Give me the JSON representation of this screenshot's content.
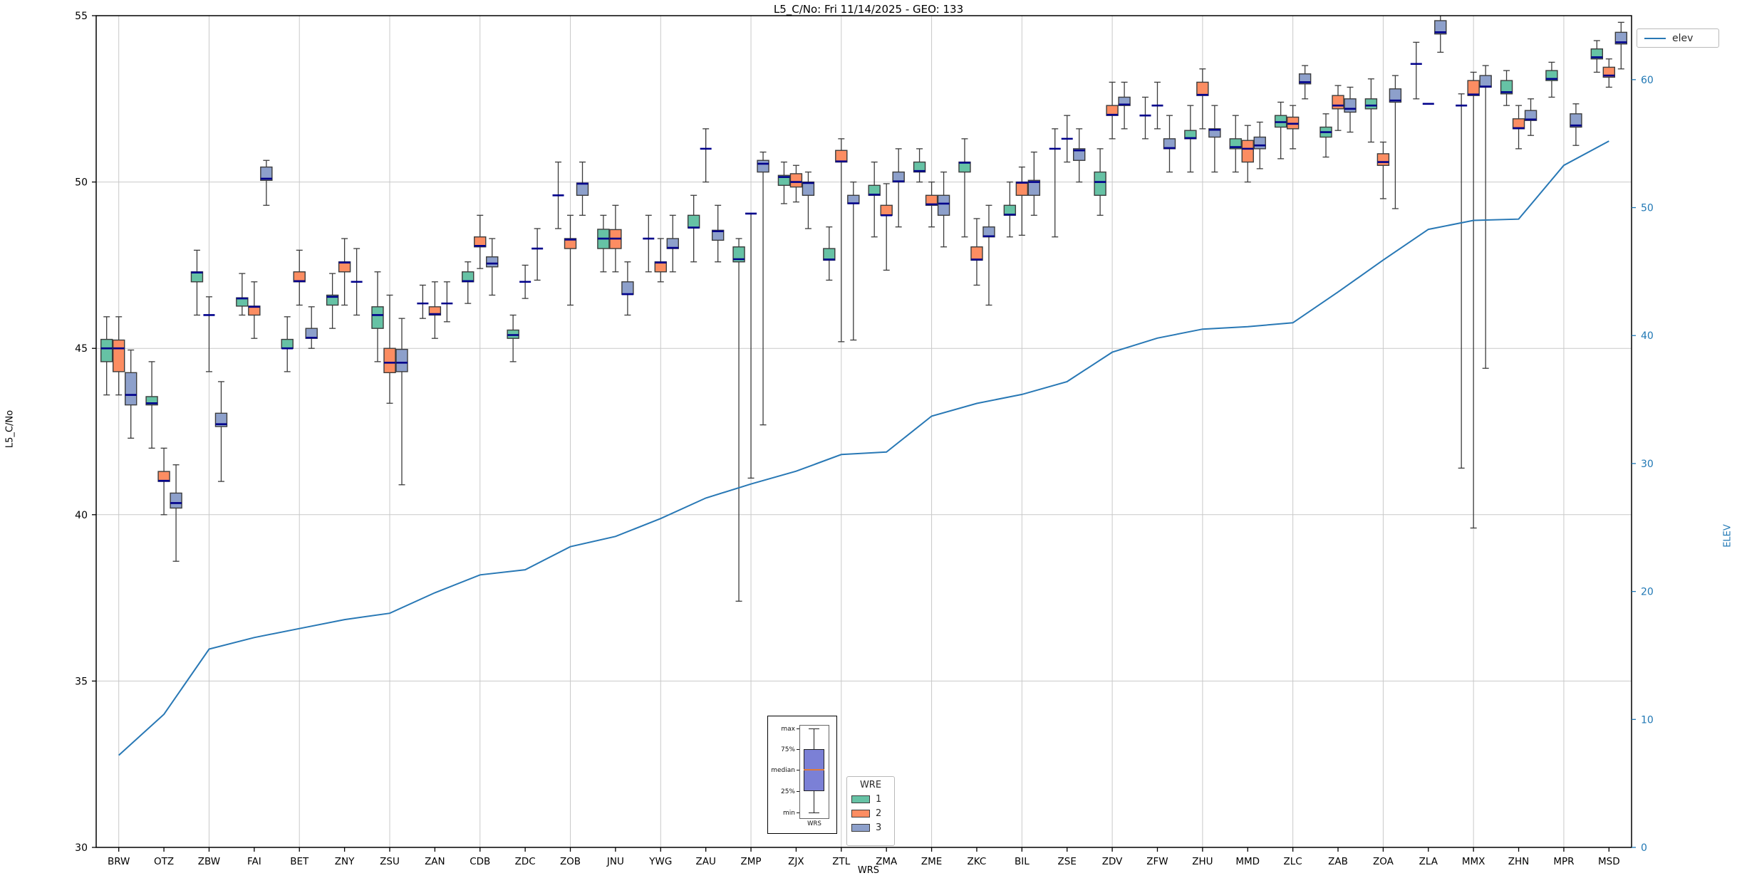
{
  "chart_data": {
    "type": "boxplot-grouped+line",
    "title": "L5_C/No: Fri 11/14/2025 - GEO: 133",
    "xlabel": "WRS",
    "ylabel_left": "L5_C/No",
    "ylabel_right": "ELEV",
    "y_left": {
      "min": 30,
      "max": 55,
      "ticks": [
        30,
        35,
        40,
        45,
        50,
        55
      ],
      "gridlines": [
        35,
        40,
        45,
        50
      ]
    },
    "y_right": {
      "min": 0,
      "max": 65,
      "ticks": [
        0,
        10,
        20,
        30,
        40,
        50,
        60
      ]
    },
    "line_legend_label": "elev",
    "wre_legend": {
      "title": "WRE",
      "items": [
        {
          "label": "1",
          "color": "#66c2a5"
        },
        {
          "label": "2",
          "color": "#fc8d62"
        },
        {
          "label": "3",
          "color": "#8da0cb"
        }
      ]
    },
    "inset": {
      "labels": [
        "max",
        "75%",
        "median",
        "25%",
        "min"
      ],
      "xlabel": "WRS"
    },
    "colors": {
      "median": "#00008b",
      "box_edge": "#3c3c3c",
      "whisker": "#3c3c3c",
      "elev_line": "#2878b5",
      "grid": "#c9c9c9",
      "right_axis": "#1f77b4"
    },
    "stations": [
      "BRW",
      "OTZ",
      "ZBW",
      "FAI",
      "BET",
      "ZNY",
      "ZSU",
      "ZAN",
      "CDB",
      "ZDC",
      "ZOB",
      "JNU",
      "YWG",
      "ZAU",
      "ZMP",
      "ZJX",
      "ZTL",
      "ZMA",
      "ZME",
      "ZKC",
      "BIL",
      "ZSE",
      "ZDV",
      "ZFW",
      "ZHU",
      "MMD",
      "ZLC",
      "ZAB",
      "ZOA",
      "ZLA",
      "MMX",
      "ZHN",
      "MPR",
      "MSD"
    ],
    "elev": [
      7.2,
      10.4,
      15.5,
      16.4,
      17.1,
      17.8,
      18.3,
      19.9,
      21.3,
      21.7,
      23.5,
      24.3,
      25.7,
      27.3,
      28.4,
      29.4,
      30.7,
      30.9,
      33.7,
      34.7,
      35.4,
      36.4,
      38.7,
      39.8,
      40.5,
      40.7,
      41.0,
      43.4,
      45.9,
      48.3,
      49.0,
      49.1,
      53.3,
      55.2
    ],
    "boxes_note": "per station: [WRE1, WRE2, WRE3]; each box = [median, q1, q3, whisker_lo, whisker_hi]; q1==q3 means flat (median-only) mark; null = absent",
    "boxes": [
      [
        [
          45.0,
          44.6,
          45.27,
          43.6,
          45.95
        ],
        [
          45.0,
          44.3,
          45.25,
          43.6,
          45.95
        ],
        [
          43.6,
          43.3,
          44.27,
          42.3,
          44.95
        ]
      ],
      [
        [
          43.35,
          43.3,
          43.55,
          42.0,
          44.6
        ],
        [
          41.02,
          41.0,
          41.3,
          40.0,
          42.0
        ],
        [
          40.35,
          40.2,
          40.65,
          38.6,
          41.5
        ]
      ],
      [
        [
          47.28,
          47.0,
          47.3,
          46.0,
          47.95
        ],
        [
          46.0,
          46.0,
          46.0,
          44.3,
          46.55
        ],
        [
          42.72,
          42.65,
          43.05,
          41.0,
          44.0
        ]
      ],
      [
        [
          46.5,
          46.27,
          46.52,
          46.0,
          47.25
        ],
        [
          46.25,
          46.0,
          46.27,
          45.3,
          47.0
        ],
        [
          50.1,
          50.05,
          50.45,
          49.3,
          50.65
        ]
      ],
      [
        [
          45.0,
          45.0,
          45.27,
          44.3,
          45.95
        ],
        [
          47.02,
          47.0,
          47.3,
          46.3,
          47.95
        ],
        [
          45.32,
          45.3,
          45.6,
          45.0,
          46.25
        ]
      ],
      [
        [
          46.55,
          46.3,
          46.6,
          45.6,
          47.25
        ],
        [
          47.58,
          47.3,
          47.6,
          46.3,
          48.3
        ],
        [
          47.0,
          47.0,
          47.0,
          46.0,
          48.0
        ]
      ],
      [
        [
          46.0,
          45.6,
          46.25,
          44.6,
          47.3
        ],
        [
          44.57,
          44.27,
          45.0,
          43.35,
          46.6
        ],
        [
          44.57,
          44.3,
          44.97,
          40.9,
          45.9
        ]
      ],
      [
        [
          46.35,
          46.35,
          46.35,
          45.9,
          46.9
        ],
        [
          46.03,
          46.0,
          46.25,
          45.3,
          47.0
        ],
        [
          46.35,
          46.35,
          46.35,
          45.8,
          47.0
        ]
      ],
      [
        [
          47.02,
          47.0,
          47.3,
          46.35,
          47.6
        ],
        [
          48.08,
          48.05,
          48.35,
          47.4,
          49.0
        ],
        [
          47.55,
          47.45,
          47.75,
          46.6,
          48.3
        ]
      ],
      [
        [
          45.4,
          45.3,
          45.55,
          44.6,
          46.0
        ],
        [
          47.0,
          47.0,
          47.0,
          46.5,
          47.5
        ],
        [
          48.0,
          48.0,
          48.0,
          47.05,
          48.6
        ]
      ],
      [
        [
          49.6,
          49.6,
          49.6,
          48.6,
          50.6
        ],
        [
          48.27,
          48.0,
          48.3,
          46.3,
          49.0
        ],
        [
          49.95,
          49.6,
          49.97,
          49.0,
          50.6
        ]
      ],
      [
        [
          48.3,
          48.0,
          48.58,
          47.3,
          49.0
        ],
        [
          48.3,
          48.0,
          48.57,
          47.3,
          49.3
        ],
        [
          46.63,
          46.62,
          47.0,
          46.0,
          47.6
        ]
      ],
      [
        [
          48.3,
          48.3,
          48.3,
          47.3,
          49.0
        ],
        [
          47.58,
          47.3,
          47.6,
          47.0,
          48.3
        ],
        [
          48.02,
          48.0,
          48.3,
          47.3,
          49.0
        ]
      ],
      [
        [
          48.63,
          48.62,
          49.0,
          47.6,
          49.6
        ],
        [
          51.0,
          51.0,
          51.0,
          50.0,
          51.6
        ],
        [
          48.52,
          48.25,
          48.55,
          47.6,
          49.3
        ]
      ],
      [
        [
          47.68,
          47.6,
          48.05,
          37.4,
          48.3
        ],
        [
          49.05,
          49.05,
          49.05,
          41.1,
          49.05
        ],
        [
          50.55,
          50.3,
          50.65,
          42.7,
          50.9
        ]
      ],
      [
        [
          50.15,
          49.9,
          50.2,
          49.35,
          50.6
        ],
        [
          50.0,
          49.85,
          50.25,
          49.4,
          50.5
        ],
        [
          49.97,
          49.6,
          50.0,
          48.6,
          50.3
        ]
      ],
      [
        [
          47.67,
          47.65,
          48.0,
          47.05,
          48.65
        ],
        [
          50.62,
          50.6,
          50.95,
          45.2,
          51.3
        ],
        [
          49.36,
          49.35,
          49.6,
          45.25,
          50.0
        ]
      ],
      [
        [
          49.62,
          49.6,
          49.9,
          48.35,
          50.6
        ],
        [
          49.0,
          49.0,
          49.3,
          47.35,
          49.95
        ],
        [
          50.02,
          50.0,
          50.3,
          48.65,
          51.0
        ]
      ],
      [
        [
          50.33,
          50.3,
          50.6,
          50.0,
          51.0
        ],
        [
          49.33,
          49.3,
          49.6,
          48.65,
          50.0
        ],
        [
          49.35,
          49.0,
          49.6,
          48.05,
          50.3
        ]
      ],
      [
        [
          50.58,
          50.3,
          50.6,
          48.35,
          51.3
        ],
        [
          47.67,
          47.65,
          48.05,
          46.9,
          48.9
        ],
        [
          48.37,
          48.35,
          48.65,
          46.3,
          49.3
        ]
      ],
      [
        [
          49.02,
          49.0,
          49.3,
          48.35,
          50.0
        ],
        [
          49.98,
          49.6,
          50.0,
          48.4,
          50.45
        ],
        [
          50.0,
          49.6,
          50.05,
          49.0,
          50.9
        ]
      ],
      [
        [
          51.0,
          51.0,
          51.0,
          48.35,
          51.6
        ],
        [
          51.3,
          51.3,
          51.3,
          50.6,
          52.0
        ],
        [
          50.95,
          50.65,
          51.0,
          50.0,
          51.6
        ]
      ],
      [
        [
          50.0,
          49.6,
          50.3,
          49.0,
          51.0
        ],
        [
          52.02,
          52.0,
          52.3,
          51.3,
          53.0
        ],
        [
          52.33,
          52.3,
          52.55,
          51.6,
          53.0
        ]
      ],
      [
        [
          52.0,
          52.0,
          52.0,
          51.3,
          52.55
        ],
        [
          52.3,
          52.3,
          52.3,
          51.6,
          53.0
        ],
        [
          51.02,
          51.0,
          51.3,
          50.3,
          52.0
        ]
      ],
      [
        [
          51.32,
          51.3,
          51.55,
          50.3,
          52.3
        ],
        [
          52.62,
          52.6,
          53.0,
          51.6,
          53.4
        ],
        [
          51.57,
          51.35,
          51.6,
          50.3,
          52.3
        ]
      ],
      [
        [
          51.05,
          51.0,
          51.3,
          50.3,
          52.0
        ],
        [
          51.0,
          50.6,
          51.25,
          50.0,
          51.7
        ],
        [
          51.1,
          51.0,
          51.35,
          50.4,
          51.8
        ]
      ],
      [
        [
          51.8,
          51.65,
          52.0,
          50.7,
          52.4
        ],
        [
          51.75,
          51.6,
          51.95,
          51.0,
          52.3
        ],
        [
          53.0,
          52.95,
          53.25,
          52.5,
          53.5
        ]
      ],
      [
        [
          51.5,
          51.35,
          51.65,
          50.75,
          52.05
        ],
        [
          52.3,
          52.2,
          52.6,
          51.55,
          52.9
        ],
        [
          52.2,
          52.1,
          52.5,
          51.5,
          52.85
        ]
      ],
      [
        [
          52.3,
          52.2,
          52.5,
          51.2,
          53.1
        ],
        [
          50.6,
          50.5,
          50.85,
          49.5,
          51.2
        ],
        [
          52.45,
          52.4,
          52.8,
          49.2,
          53.2
        ]
      ],
      [
        [
          53.55,
          53.55,
          53.55,
          52.5,
          54.2
        ],
        [
          52.35,
          52.35,
          52.35,
          52.35,
          52.35
        ],
        [
          54.5,
          54.45,
          54.85,
          53.9,
          55.05
        ]
      ],
      [
        [
          52.3,
          52.3,
          52.3,
          41.4,
          52.65
        ],
        [
          52.63,
          52.6,
          53.05,
          39.6,
          53.3
        ],
        [
          52.87,
          52.85,
          53.2,
          44.4,
          53.5
        ]
      ],
      [
        [
          52.7,
          52.65,
          53.05,
          52.3,
          53.35
        ],
        [
          51.62,
          51.6,
          51.9,
          51.0,
          52.3
        ],
        [
          51.88,
          51.85,
          52.15,
          51.4,
          52.5
        ]
      ],
      [
        [
          53.1,
          53.05,
          53.35,
          52.55,
          53.6
        ],
        null,
        [
          51.7,
          51.65,
          52.05,
          51.1,
          52.35
        ]
      ],
      [
        [
          53.75,
          53.7,
          54.0,
          53.3,
          54.25
        ],
        [
          53.2,
          53.15,
          53.45,
          52.85,
          53.7
        ],
        [
          54.2,
          54.15,
          54.5,
          53.4,
          54.8
        ]
      ]
    ]
  }
}
